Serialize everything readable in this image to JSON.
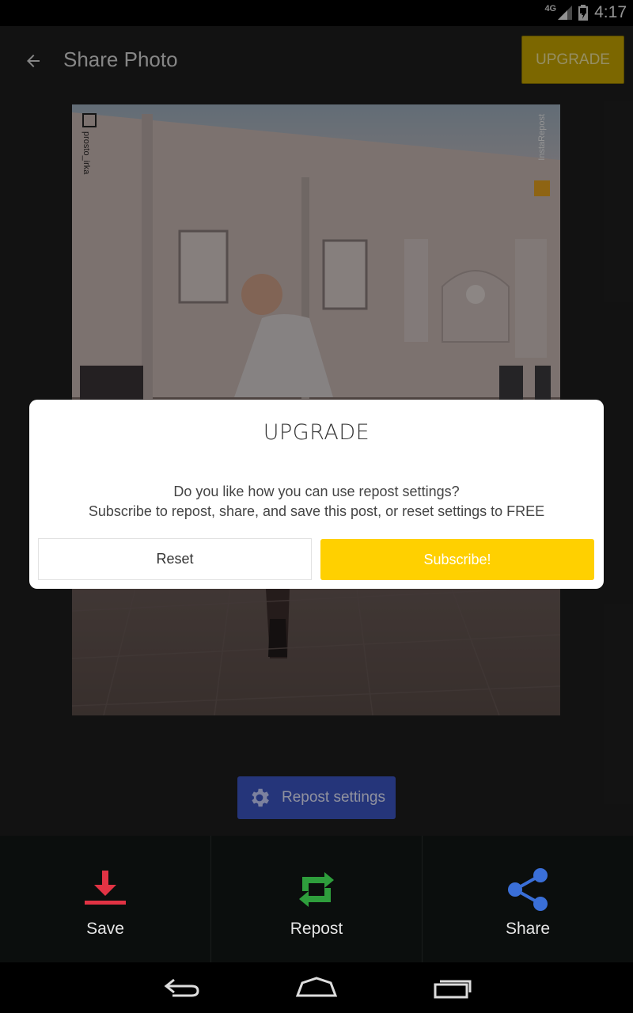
{
  "status_bar": {
    "network": "4G",
    "time": "4:17"
  },
  "app_bar": {
    "title": "Share Photo",
    "upgrade_label": "UPGRADE",
    "back_icon": "arrow-back-icon"
  },
  "photo": {
    "watermark_user": "prosto_irka",
    "watermark_app": "InstaRepost"
  },
  "dialog": {
    "title": "UPGRADE",
    "message_line1": "Do you like how you can use repost settings?",
    "message_line2": "Subscribe to repost, share, and save this post, or reset settings to FREE",
    "reset_label": "Reset",
    "subscribe_label": "Subscribe!"
  },
  "repost_settings": {
    "label": "Repost settings",
    "icon": "gear-icon"
  },
  "bottom_actions": [
    {
      "label": "Save",
      "icon": "download-icon",
      "color": "#e23344"
    },
    {
      "label": "Repost",
      "icon": "repost-icon",
      "color": "#2e9e3c"
    },
    {
      "label": "Share",
      "icon": "share-icon",
      "color": "#3a6fd8"
    }
  ],
  "colors": {
    "accent_yellow": "#ffd000",
    "upgrade_dimmed": "#c9a700",
    "repost_settings_blue": "#3d56c6",
    "background": "#1e1e1e"
  }
}
